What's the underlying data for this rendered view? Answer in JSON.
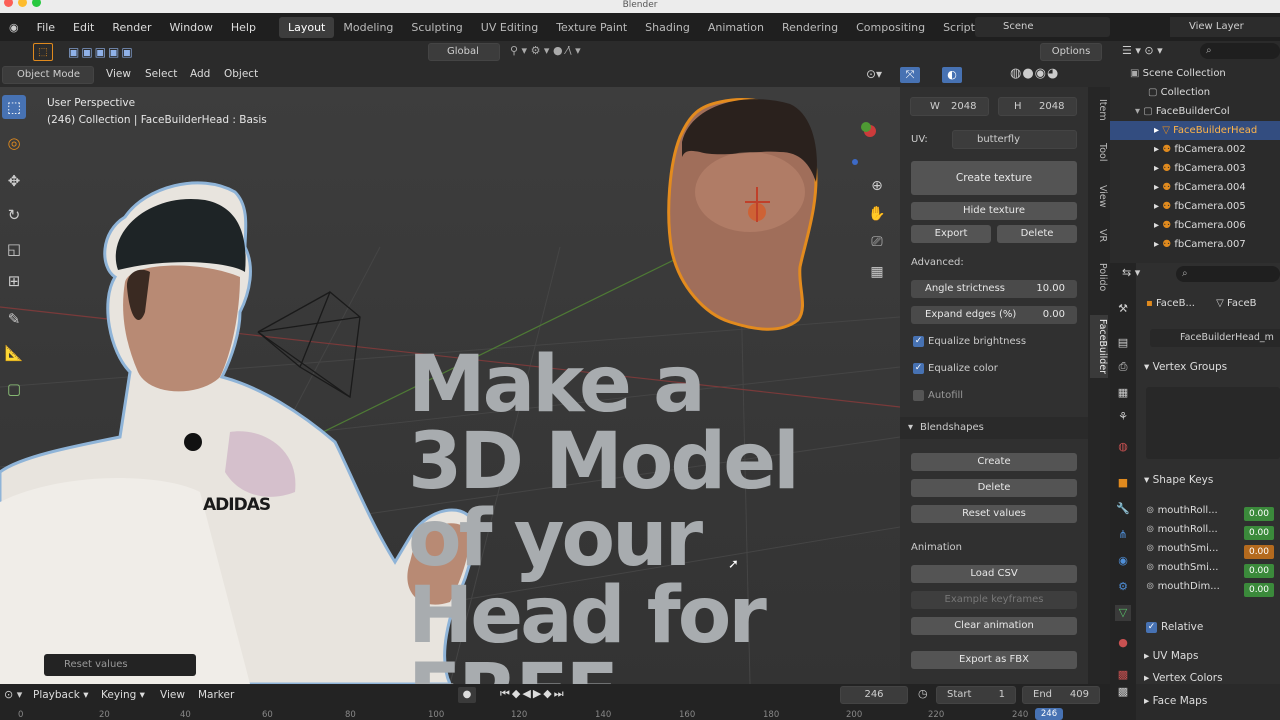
{
  "window": {
    "title": "Blender"
  },
  "menubar": {
    "items": [
      "File",
      "Edit",
      "Render",
      "Window",
      "Help"
    ]
  },
  "workspaces": [
    "Layout",
    "Modeling",
    "Sculpting",
    "UV Editing",
    "Texture Paint",
    "Shading",
    "Animation",
    "Rendering",
    "Compositing",
    "Scripting"
  ],
  "workspace_add": "+",
  "scene": {
    "label": "Scene",
    "view_layer": "View Layer"
  },
  "transform": {
    "orientation": "Global",
    "options": "Options"
  },
  "viewport_header": {
    "mode": "Object Mode",
    "menus": [
      "View",
      "Select",
      "Add",
      "Object"
    ]
  },
  "viewport": {
    "perspective": "User Perspective",
    "info": "(246) Collection | FaceBuilderHead : Basis",
    "last_op": "Reset values"
  },
  "headline": [
    "Make a",
    "3D Model",
    "of your",
    "Head for",
    "FREE"
  ],
  "shirt_text": "ADIDAS",
  "npanel": {
    "w_label": "W",
    "w_value": "2048",
    "h_label": "H",
    "h_value": "2048",
    "uv_label": "UV:",
    "uv_value": "butterfly",
    "create_texture": "Create texture",
    "hide_texture": "Hide texture",
    "export": "Export",
    "delete": "Delete",
    "advanced": "Advanced:",
    "angle_label": "Angle strictness",
    "angle_value": "10.00",
    "expand_label": "Expand edges (%)",
    "expand_value": "0.00",
    "equalize_brightness": "Equalize brightness",
    "equalize_color": "Equalize color",
    "autofill": "Autofill",
    "blendshapes": "Blendshapes",
    "create": "Create",
    "delete2": "Delete",
    "reset_values": "Reset values",
    "animation": "Animation",
    "load_csv": "Load CSV",
    "example_keyframes": "Example keyframes",
    "clear_animation": "Clear animation",
    "export_fbx": "Export as FBX"
  },
  "side_tabs": [
    "Item",
    "Tool",
    "View",
    "VR",
    "Polido",
    "FaceBuilder"
  ],
  "outliner": {
    "rows": [
      "Scene Collection",
      "Collection",
      "FaceBuilderCol",
      "FaceBuilderHead",
      "fbCamera.002",
      "fbCamera.003",
      "fbCamera.004",
      "fbCamera.005",
      "fbCamera.006",
      "fbCamera.007"
    ]
  },
  "properties": {
    "obj_name": "FaceB...",
    "mesh_name": "FaceB",
    "data_name": "FaceBuilderHead_m",
    "vertex_groups": "Vertex Groups",
    "shape_keys": "Shape Keys",
    "keys": [
      {
        "name": "mouthRoll...",
        "value": "0.00"
      },
      {
        "name": "mouthRoll...",
        "value": "0.00"
      },
      {
        "name": "mouthSmi...",
        "value": "0.00"
      },
      {
        "name": "mouthSmi...",
        "value": "0.00"
      },
      {
        "name": "mouthDim...",
        "value": "0.00"
      }
    ],
    "relative": "Relative",
    "uv_maps": "UV Maps",
    "vertex_colors": "Vertex Colors",
    "face_maps": "Face Maps"
  },
  "timeline": {
    "menus": [
      "Playback",
      "Keying",
      "View",
      "Marker"
    ],
    "current_frame": "246",
    "start_label": "Start",
    "start": "1",
    "end_label": "End",
    "end": "409",
    "ticks": [
      "0",
      "20",
      "40",
      "60",
      "80",
      "100",
      "120",
      "140",
      "160",
      "180",
      "200",
      "220",
      "240"
    ]
  },
  "colors": {
    "accent": "#4772b3",
    "active_row": "#334d80",
    "orange": "#e08a1e",
    "green": "#3b8a3b",
    "headline": "#a8acaf"
  },
  "icons": [
    "select-box-icon",
    "cursor-icon",
    "move-icon",
    "rotate-icon",
    "scale-icon",
    "transform-icon",
    "annotate-icon",
    "measure-icon",
    "add-cube-icon",
    "zoom-icon",
    "hand-icon",
    "camera-icon",
    "grid-icon",
    "play-icon",
    "clock-icon"
  ]
}
